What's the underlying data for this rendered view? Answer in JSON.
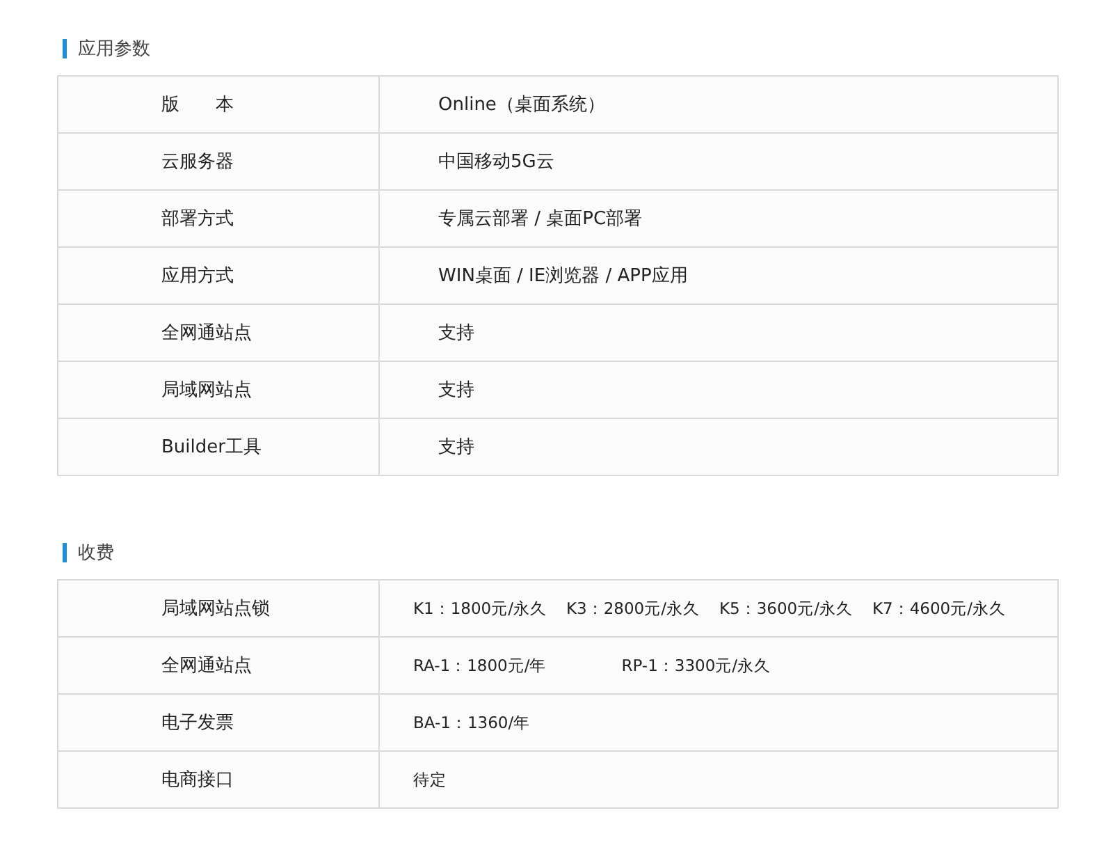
{
  "sections": [
    {
      "title": "应用参数",
      "rows": [
        {
          "label": "版　　本",
          "values": [
            "Online（桌面系统）"
          ]
        },
        {
          "label": "云服务器",
          "values": [
            "中国移动5G云"
          ]
        },
        {
          "label": "部署方式",
          "values": [
            "专属云部署 / 桌面PC部署"
          ]
        },
        {
          "label": "应用方式",
          "values": [
            "WIN桌面 / IE浏览器 / APP应用"
          ]
        },
        {
          "label": "全网通站点",
          "values": [
            "支持"
          ]
        },
        {
          "label": "局域网站点",
          "values": [
            "支持"
          ]
        },
        {
          "label": "Builder工具",
          "values": [
            "支持"
          ]
        }
      ]
    },
    {
      "title": "收费",
      "rows": [
        {
          "label": "局域网站点锁",
          "values": [
            "K1：1800元/永久",
            "K3：2800元/永久",
            "K5：3600元/永久",
            "K7：4600元/永久"
          ]
        },
        {
          "label": "全网通站点",
          "values": [
            "RA-1：1800元/年",
            "RP-1：3300元/永久"
          ]
        },
        {
          "label": "电子发票",
          "values": [
            "BA-1：1360/年"
          ]
        },
        {
          "label": "电商接口",
          "values": [
            "待定"
          ]
        }
      ]
    }
  ]
}
